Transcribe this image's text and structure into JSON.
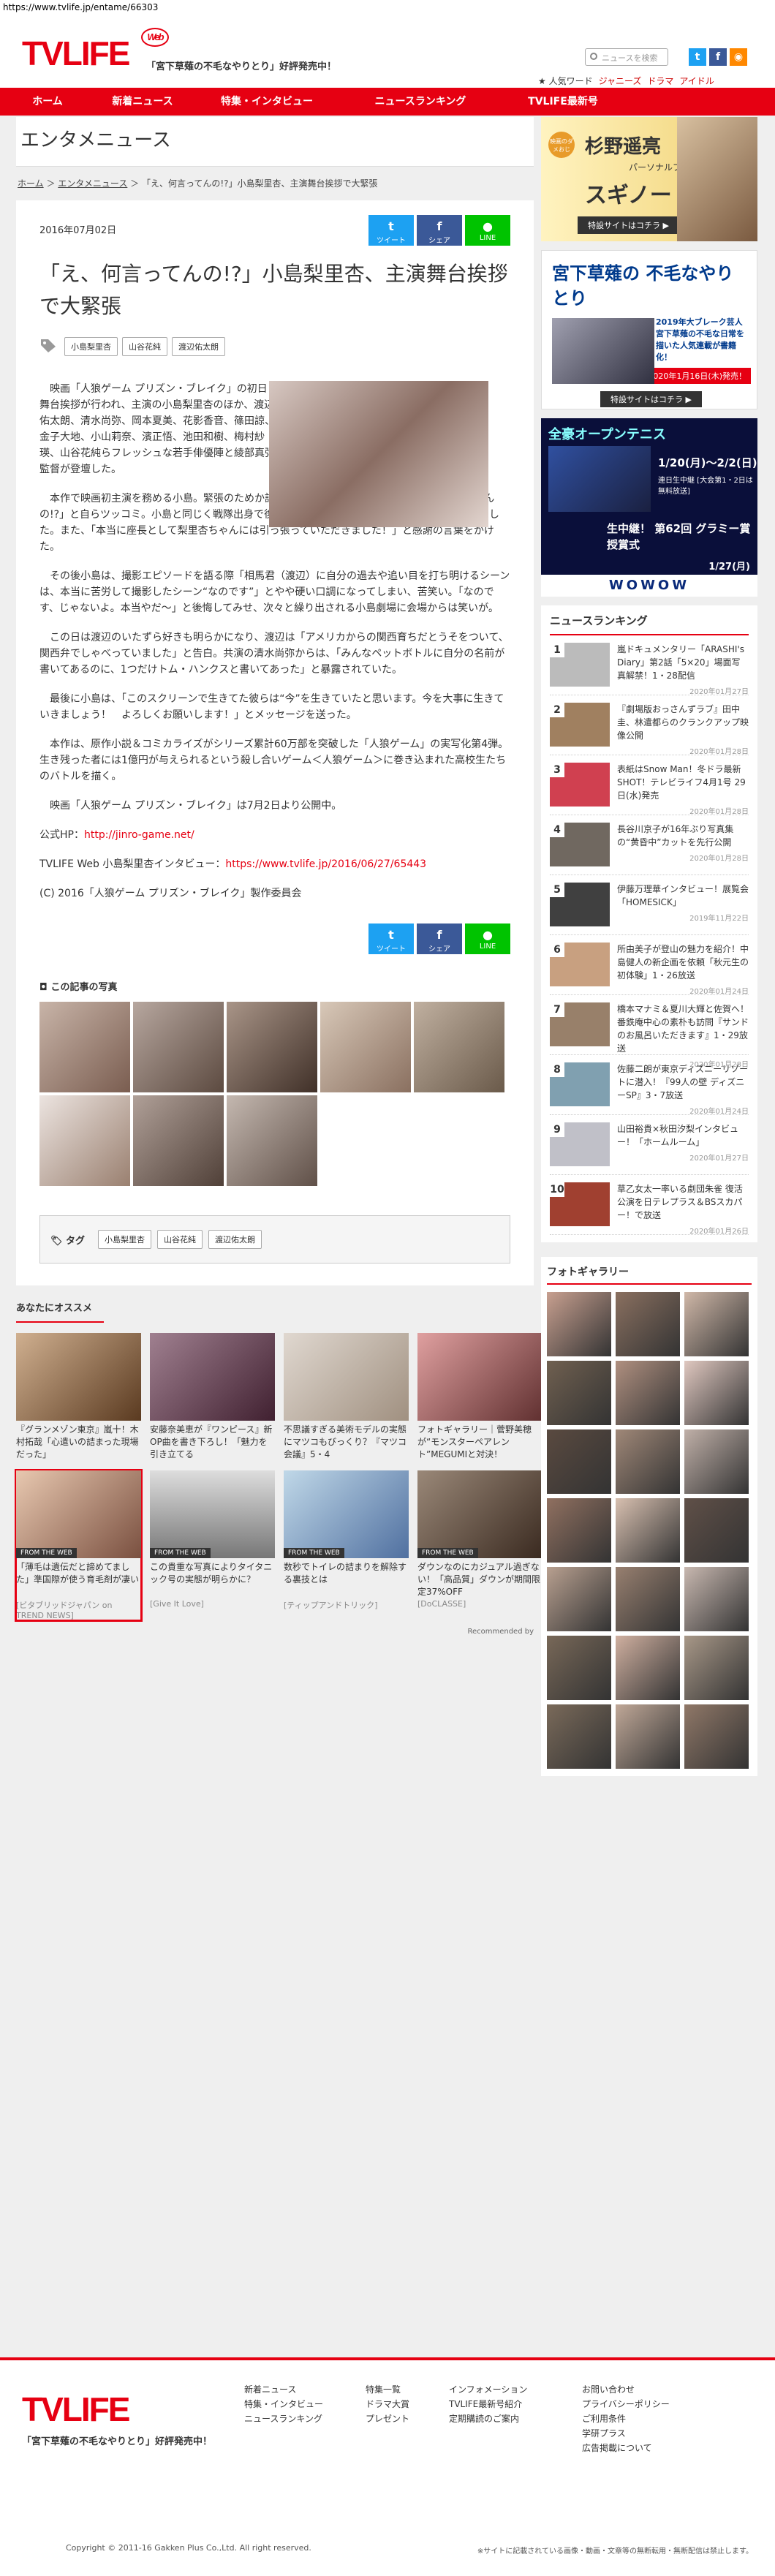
{
  "url": "https://www.tvlife.jp/entame/66303",
  "header": {
    "logo": "TVLIFE",
    "logo_badge": "Web",
    "tagline": "「宮下草薙の不毛なやりとり」好評発売中！",
    "search_placeholder": "ニュースを検索",
    "hot_label": "★ 人気ワード",
    "hot_words": [
      "ジャニーズ",
      "ドラマ",
      "アイドル"
    ]
  },
  "nav": [
    "ホーム",
    "新着ニュース",
    "特集・インタビュー",
    "ニュースランキング",
    "TVLIFE最新号"
  ],
  "page": {
    "section_title": "エンタメニュース",
    "breadcrumb": [
      "ホーム",
      "エンタメニュース",
      "「え、何言ってんの!?」小島梨里杏、主演舞台挨拶で大緊張"
    ]
  },
  "article": {
    "date": "2016年07月02日",
    "share": [
      "ツイート",
      "シェア",
      "LINE"
    ],
    "title": "「え、何言ってんの!?」小島梨里杏、主演舞台挨拶で大緊張",
    "tags": [
      "小島梨里杏",
      "山谷花純",
      "渡辺佑太朗"
    ],
    "paragraphs": [
      "映画「人狼ゲーム プリズン・ブレイク」の初日舞台挨拶が行われ、主演の小島梨里杏のほか、渡辺佑太朗、清水尚弥、岡本夏美、花影香音、篠田諒、金子大地、小山莉奈、濱正悟、池田和樹、梅村紗瑛、山谷花純らフレッシュな若手俳優陣と綾部真弥監督が登壇した。",
      "本作で映画初主演を務める小島。緊張のためか話の途中で言葉に詰まり「え、（自分）何言ってんの!?」と自らツッコミ。小島と同じく戦隊出身で後輩にあたる山谷は、緊張する小島を笑顔で励ました。また、「本当に座長として梨里杏ちゃんには引っ張っていただきました！」と感謝の言葉をかけた。",
      "その後小島は、撮影エピソードを語る際「相馬君（渡辺）に自分の過去や追い目を打ち明けるシーンは、本当に苦労して撮影したシーン“なのです”」とやや硬い口調になってしまい、苦笑い。「なのです、じゃないよ。本当やだ～」と後悔してみせ、次々と繰り出される小島劇場に会場からは笑いが。",
      "この日は渡辺のいたずら好きも明らかになり、渡辺は「アメリカからの関西育ちだとうそをついて、関西弁でしゃべっていました」と告白。共演の清水尚弥からは、「みんなペットボトルに自分の名前が書いてあるのに、1つだけトム・ハンクスと書いてあった」と暴露されていた。",
      "最後に小島は、「このスクリーンで生きてた彼らは“今”を生きていたと思います。今を大事に生きていきましょう！　よろしくお願いします！」とメッセージを送った。",
      "本作は、原作小説＆コミカライズがシリーズ累計60万部を突破した「人狼ゲーム」の実写化第4弾。生き残った者には1億円が与えられるという殺し合いゲーム＜人狼ゲーム＞に巻き込まれた高校生たちのバトルを描く。",
      "映画「人狼ゲーム プリズン・ブレイク」は7月2日より公開中。"
    ],
    "official_label": "公式HP：",
    "official_url": "http://jinro-game.net/",
    "interview_label": "TVLIFE Web 小島梨里杏インタビュー：",
    "interview_url": "https://www.tvlife.jp/2016/06/27/65443",
    "copyright": "(C) 2016「人狼ゲーム プリズン・ブレイク」製作委員会",
    "gallery_title": "この記事の写真",
    "tag_label": "タグ"
  },
  "recommend": {
    "title": "あなたにオススメ",
    "items": [
      {
        "cap": "『グランメゾン東京』嵐十！木村拓哉「心遣いの詰まった現場だった」",
        "src": ""
      },
      {
        "cap": "安藤奈美恵が『ワンピース』新OP曲を書き下ろし！「魅力を引き立てる",
        "src": ""
      },
      {
        "cap": "不思議すぎる美術モデルの実態にマツコもびっくり？『マツコ会議』5・4",
        "src": ""
      },
      {
        "cap": "フォトギャラリー｜菅野美穂が“モンスターペアレント”MEGUMIと対決！",
        "src": ""
      },
      {
        "cap": "「薄毛は遺伝だと諦めてました」準国際が使う育毛剤が凄い",
        "src": "[ビタブリッドジャパン on TREND NEWS]",
        "fw": "FROM THE WEB"
      },
      {
        "cap": "この貴重な写真によりタイタニック号の実態が明らかに？",
        "src": "[Give It Love]",
        "fw": "FROM THE WEB"
      },
      {
        "cap": "数秒でトイレの詰まりを解除する裏技とは",
        "src": "[ティップアンドトリック]",
        "fw": "FROM THE WEB"
      },
      {
        "cap": "ダウンなのにカジュアル過ぎない！「高品質」ダウンが期間限定37%OFF",
        "src": "[DoCLASSE]",
        "fw": "FROM THE WEB"
      }
    ],
    "by": "Recommended by"
  },
  "side": {
    "ad1": {
      "small": "映画のダメおじ",
      "title": "杉野遥亮",
      "sub": "パーソナルブック",
      "name": "スギノート",
      "btn": "特設サイトはコチラ ▶"
    },
    "ad2": {
      "title": "宮下草薙の 不毛なやりとり",
      "note": "2019年大ブレーク芸人 宮下草薙の不毛な日常を描いた人気連載が書籍化！",
      "date": "2020年1月16日(木)発売！",
      "btn": "特設サイトはコチラ ▶"
    },
    "ad3": {
      "title": "全豪オープンテニス",
      "d1": "1/20(月)～2/2(日)",
      "d1n": "連日生中継 [大会第1・2日は無料放送]",
      "live": "生中継！ 第62回 グラミー賞授賞式",
      "d2": "1/27(月)",
      "brand": "WOWOW"
    },
    "ranking": {
      "title": "ニュースランキング",
      "items": [
        {
          "t": "嵐ドキュメンタリー「ARASHI's Diary」第2話「5×20」場面写真解禁！1・28配信",
          "d": "2020年01月27日"
        },
        {
          "t": "『劇場版おっさんずラブ』田中圭、林遣都らのクランクアップ映像公開",
          "d": "2020年01月28日"
        },
        {
          "t": "表紙はSnow Man！冬ドラ最新SHOT！テレビライフ4月1号 29日(水)発売",
          "d": "2020年01月28日"
        },
        {
          "t": "長谷川京子が16年ぶり写真集の“黄昏中”カットを先行公開",
          "d": "2020年01月28日"
        },
        {
          "t": "伊藤万理華インタビュー！展覧会「HOMESICK」",
          "d": "2019年11月22日"
        },
        {
          "t": "所由美子が登山の魅力を紹介！中島健人の新企画を依頼「秋元生の初体験」1・26放送",
          "d": "2020年01月24日"
        },
        {
          "t": "橋本マナミ＆夏川大輝と佐賀へ！番鉄庵中心の素朴も訪問『サンドのお風呂いただきます』1・29放送",
          "d": "2020年01月28日"
        },
        {
          "t": "佐藤二朗が東京ディズニーリゾートに潜入！『99人の壁 ディズニーSP』3・7放送",
          "d": "2020年01月24日"
        },
        {
          "t": "山田裕貴×秋田汐梨インタビュー！「ホームルーム」",
          "d": "2020年01月27日"
        },
        {
          "t": "草乙女太一率いる劇団朱雀 復活公演を日テレプラス＆BSスカパー！で放送",
          "d": "2020年01月26日"
        }
      ]
    },
    "photo_title": "フォトギャラリー"
  },
  "footer": {
    "logo": "TVLIFE",
    "tagline": "「宮下草薙の不毛なやりとり」好評発売中！",
    "col1": [
      "新着ニュース",
      "特集・インタビュー",
      "ニュースランキング"
    ],
    "col2": [
      "特集一覧",
      "ドラマ大賞",
      "プレゼント"
    ],
    "col3": [
      "インフォメーション",
      "TVLIFE最新号紹介",
      "定期購読のご案内"
    ],
    "col4": [
      "お問い合わせ",
      "プライバシーポリシー",
      "ご利用条件",
      "学研プラス",
      "広告掲載について"
    ],
    "copy": "Copyright © 2011-16 Gakken Plus Co.,Ltd. All right reserved.",
    "note": "※サイトに記載されている画像・動画・文章等の無断転用・無断配信は禁止します。"
  }
}
